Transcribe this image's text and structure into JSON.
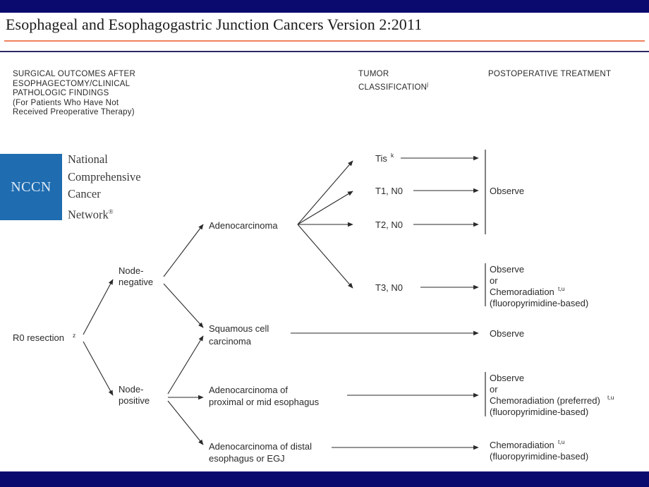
{
  "slide": {
    "title": "Esophageal and Esophagogastric Junction Cancers Version 2:2011",
    "bar_color": "#0a0a6e",
    "rule_coral_color": "#f0825e",
    "rule_navy_color": "#2b2b68"
  },
  "logo": {
    "mark": "NCCN",
    "box_color": "#1f6cb0",
    "words": "National\nComprehensive\nCancer\nNetwork",
    "registered_mark": "®"
  },
  "columns": {
    "surgical": "SURGICAL OUTCOMES AFTER\nESOPHAGECTOMY/CLINICAL\nPATHOLOGIC FINDINGS\n(For Patients Who Have Not\nReceived Preoperative Therapy)",
    "tumor": "TUMOR\nCLASSIFICATION",
    "tumor_sup": "j",
    "postop": "POSTOPERATIVE TREATMENT"
  },
  "nodes": {
    "root": {
      "label": "R0 resection",
      "sup": "z"
    },
    "node_negative": {
      "line1": "Node-",
      "line2": "negative"
    },
    "node_positive": {
      "line1": "Node-",
      "line2": "positive"
    },
    "adenocarcinoma": {
      "label": "Adenocarcinoma"
    },
    "squamous": {
      "line1": "Squamous cell",
      "line2": "carcinoma"
    },
    "adeno_proximal": {
      "line1": "Adenocarcinoma of",
      "line2": "proximal or mid esophagus"
    },
    "adeno_distal": {
      "line1": "Adenocarcinoma of distal",
      "line2": "esophagus or EGJ"
    }
  },
  "tumor_classes": [
    {
      "label": "Tis",
      "sup": "k"
    },
    {
      "label": "T1, N0",
      "sup": ""
    },
    {
      "label": "T2, N0",
      "sup": ""
    },
    {
      "label": "T3, N0",
      "sup": ""
    }
  ],
  "treatments": {
    "observe_group": {
      "label": "Observe"
    },
    "t3_group": {
      "line1": "Observe",
      "line2": "or",
      "line3": "Chemoradiation",
      "line3_sup": "t,u",
      "line4": "(fluoropyrimidine-based)"
    },
    "squamous_group": {
      "label": "Observe"
    },
    "proximal_group": {
      "line1": "Observe",
      "line2": "or",
      "line3": "Chemoradiation (preferred)",
      "line3_sup": "t,u",
      "line4": "(fluoropyrimidine-based)"
    },
    "distal_group": {
      "line1": "Chemoradiation",
      "line1_sup": "t,u",
      "line2": "(fluoropyrimidine-based)"
    }
  }
}
